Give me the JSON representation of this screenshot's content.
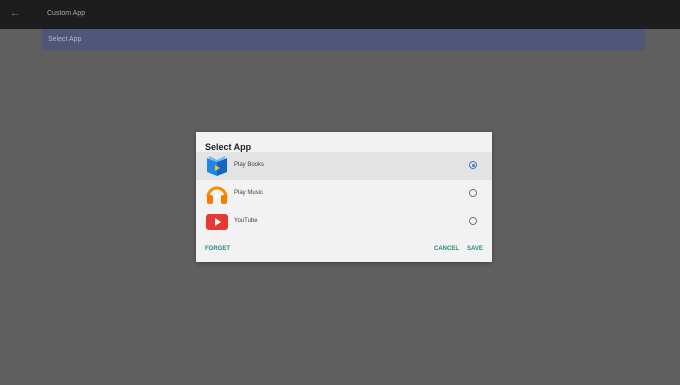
{
  "header": {
    "title": "Custom App"
  },
  "setting_row": {
    "label": "Select App"
  },
  "dialog": {
    "title": "Select App",
    "apps": [
      {
        "label": "Play Books",
        "icon": "play-books-icon",
        "selected": true
      },
      {
        "label": "Play Music",
        "icon": "play-music-icon",
        "selected": false
      },
      {
        "label": "YouTube",
        "icon": "youtube-icon",
        "selected": false
      }
    ],
    "forget_label": "FORGET",
    "cancel_label": "CANCEL",
    "save_label": "SAVE"
  },
  "colors": {
    "accent": "#2a8a7d",
    "radio_selected": "#4279c7",
    "header_bg": "#1d1d1d",
    "row_bg": "#4f5677",
    "backdrop": "#5f5f5f"
  }
}
